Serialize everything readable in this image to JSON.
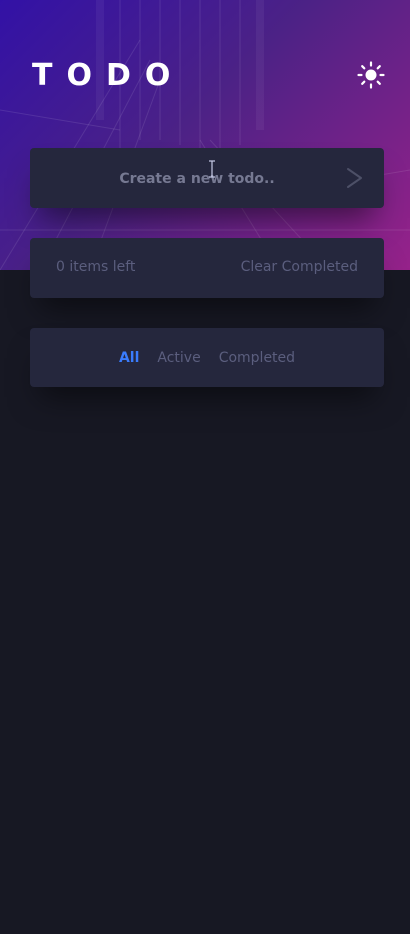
{
  "header": {
    "title": "TODO",
    "theme_toggle_icon": "sun-icon"
  },
  "new_todo": {
    "placeholder": "Create a new todo..",
    "value": "",
    "submit_icon": "chevron-right-icon"
  },
  "status_bar": {
    "items_left": "0 items left",
    "clear_completed_label": "Clear Completed"
  },
  "filters": {
    "all_label": "All",
    "active_label": "Active",
    "completed_label": "Completed",
    "selected": "All"
  },
  "colors": {
    "background": "#171823",
    "card": "#25273D",
    "accent": "#3A7CFD",
    "muted_text": "#5B5E7E",
    "gradient_start": "#3710BD",
    "gradient_end": "#A42395"
  }
}
